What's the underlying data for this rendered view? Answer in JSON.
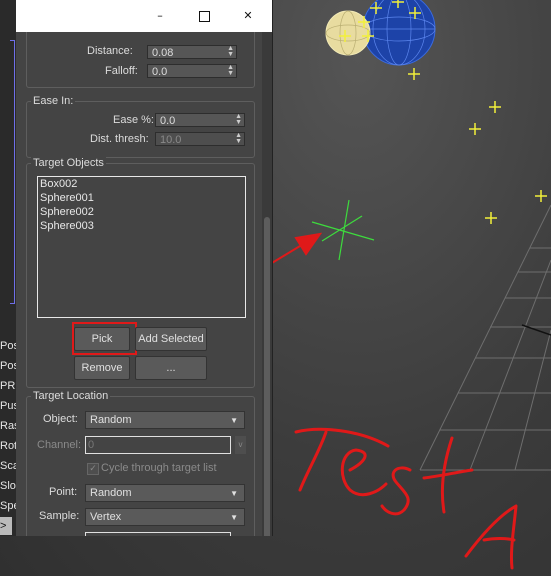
{
  "window": {
    "minimize_icon": "minimize-icon",
    "maximize_icon": "maximize-icon",
    "close_icon": "close-icon"
  },
  "distance_affect": {
    "distance_label": "Distance:",
    "distance_value": "0.08",
    "falloff_label": "Falloff:",
    "falloff_value": "0.0"
  },
  "ease_in": {
    "title": "Ease In:",
    "ease_label": "Ease %:",
    "ease_value": "0.0",
    "dist_thresh_label": "Dist. thresh:",
    "dist_thresh_value": "10.0"
  },
  "target_objects": {
    "title": "Target Objects",
    "items": [
      "Box002",
      "Sphere001",
      "Sphere002",
      "Sphere003"
    ],
    "pick_label": "Pick",
    "add_selected_label": "Add Selected",
    "remove_label": "Remove",
    "more_label": "..."
  },
  "target_location": {
    "title": "Target Location",
    "object_label": "Object:",
    "object_value": "Random",
    "channel_label": "Channel:",
    "channel_value": "0",
    "cycle_label": "Cycle through target list",
    "point_label": "Point:",
    "point_value": "Random",
    "sample_label": "Sample:",
    "sample_value": "Vertex"
  },
  "left_strip": [
    "Pos",
    "Pos",
    "PR",
    "Pus",
    "Ras",
    "Rot",
    "Sca",
    "Slo",
    "Spe"
  ],
  "left_strip_caret": ">",
  "annotation": {
    "handwriting": "TestA",
    "color": "#e01919"
  }
}
